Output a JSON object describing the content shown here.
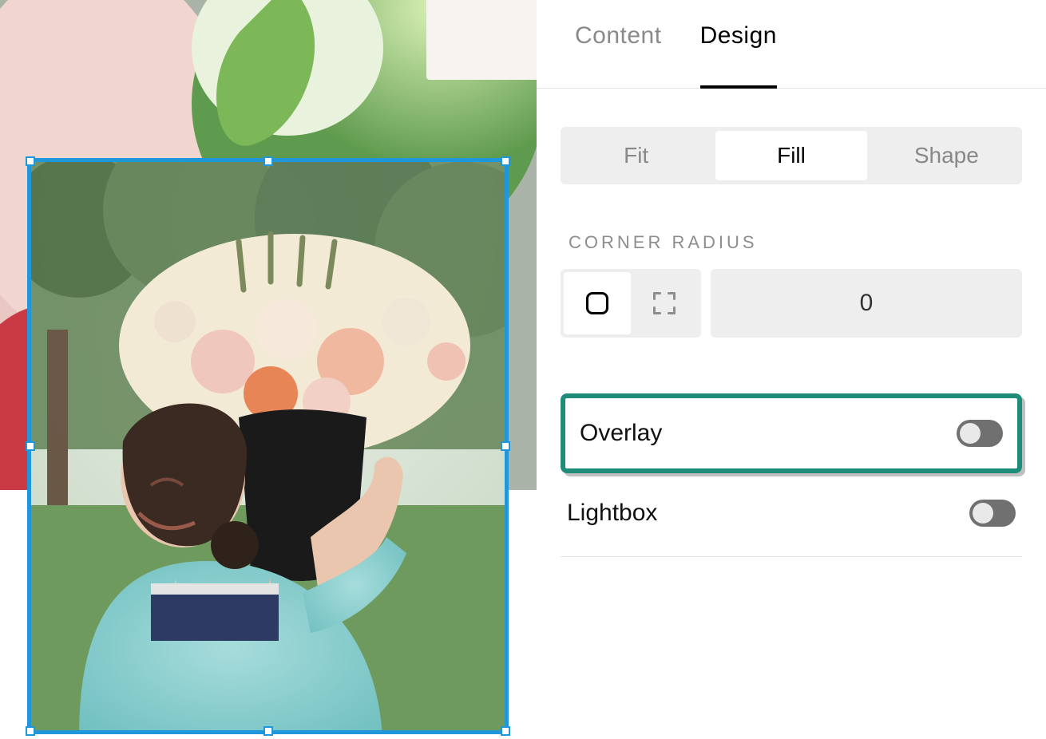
{
  "tabs": {
    "content": "Content",
    "design": "Design",
    "active": "design"
  },
  "fit_modes": {
    "fit": "Fit",
    "fill": "Fill",
    "shape": "Shape",
    "active": "fill"
  },
  "corner_radius": {
    "label": "Corner Radius",
    "value": "0"
  },
  "overlay": {
    "label": "Overlay",
    "on": false
  },
  "lightbox": {
    "label": "Lightbox",
    "on": false
  }
}
